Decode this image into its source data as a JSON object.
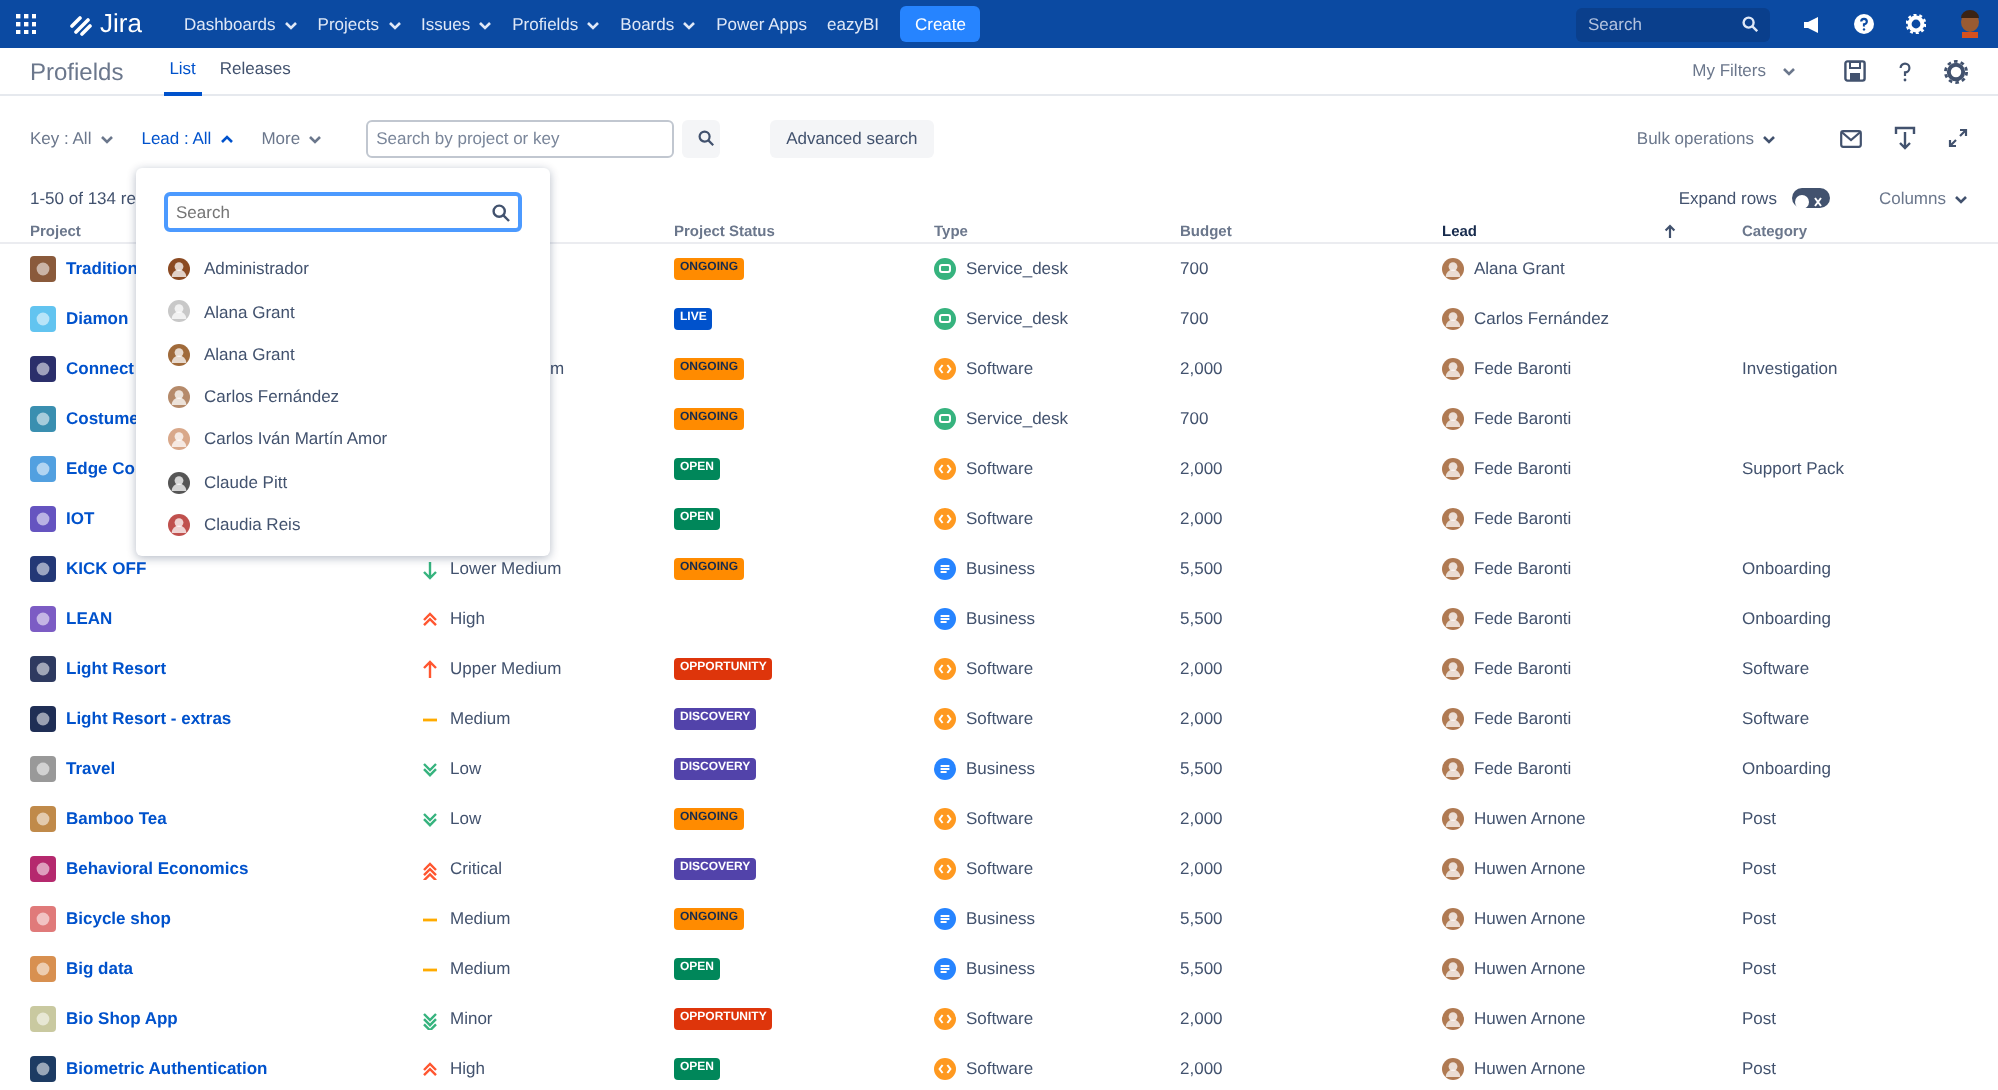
{
  "nav": {
    "logo": "Jira",
    "menus": [
      {
        "label": "Dashboards",
        "has_menu": true
      },
      {
        "label": "Projects",
        "has_menu": true
      },
      {
        "label": "Issues",
        "has_menu": true
      },
      {
        "label": "Profields",
        "has_menu": true
      },
      {
        "label": "Boards",
        "has_menu": true
      },
      {
        "label": "Power Apps",
        "has_menu": false
      },
      {
        "label": "eazyBI",
        "has_menu": false
      }
    ],
    "create": "Create",
    "search": {
      "placeholder": "Search"
    }
  },
  "header": {
    "title": "Profields",
    "tabs": [
      {
        "label": "List",
        "selected": true
      },
      {
        "label": "Releases",
        "selected": false
      }
    ],
    "my_filters": "My Filters"
  },
  "toolbar": {
    "filters": [
      {
        "label": "Key : All",
        "expanded": false
      },
      {
        "label": "Lead : All",
        "expanded": true
      },
      {
        "label": "More",
        "expanded": false
      }
    ],
    "search": {
      "placeholder": "Search by project or key"
    },
    "advanced_search": "Advanced search",
    "bulk_operations": "Bulk operations"
  },
  "results": "1-50 of 134 re",
  "expand_rows": {
    "label": "Expand rows",
    "on": false
  },
  "columns_button": "Columns",
  "table": {
    "columns": [
      {
        "label": "Project",
        "sorted": false
      },
      {
        "label": "Project Status",
        "sorted": false
      },
      {
        "label": "Type",
        "sorted": false
      },
      {
        "label": "Budget",
        "sorted": false
      },
      {
        "label": "Lead",
        "sorted": true
      },
      {
        "label": "Category",
        "sorted": false
      }
    ],
    "rows": [
      {
        "project": "Tradition",
        "status": {
          "label": "ONGOING",
          "kind": "ongoing"
        },
        "type": {
          "label": "Service_desk",
          "kind": "service_desk"
        },
        "budget": "700",
        "lead": "Alana Grant"
      },
      {
        "project": "Diamon",
        "status": {
          "label": "LIVE",
          "kind": "live"
        },
        "type": {
          "label": "Service_desk",
          "kind": "service_desk"
        },
        "budget": "700",
        "lead": "Carlos Fernández"
      },
      {
        "project": "Connect",
        "priority": {
          "label": "m"
        },
        "status": {
          "label": "ONGOING",
          "kind": "ongoing"
        },
        "type": {
          "label": "Software",
          "kind": "software"
        },
        "budget": "2,000",
        "lead": "Fede Baronti",
        "category": "Investigation"
      },
      {
        "project": "Costume",
        "status": {
          "label": "ONGOING",
          "kind": "ongoing"
        },
        "type": {
          "label": "Service_desk",
          "kind": "service_desk"
        },
        "budget": "700",
        "lead": "Fede Baronti"
      },
      {
        "project": "Edge Co",
        "status": {
          "label": "OPEN",
          "kind": "open"
        },
        "type": {
          "label": "Software",
          "kind": "software"
        },
        "budget": "2,000",
        "lead": "Fede Baronti",
        "category": "Support Pack"
      },
      {
        "project": "IOT",
        "status": {
          "label": "OPEN",
          "kind": "open"
        },
        "type": {
          "label": "Software",
          "kind": "software"
        },
        "budget": "2,000",
        "lead": "Fede Baronti"
      },
      {
        "project": "KICK OFF",
        "priority": {
          "label": "Lower Medium",
          "kind": "down"
        },
        "status": {
          "label": "ONGOING",
          "kind": "ongoing"
        },
        "type": {
          "label": "Business",
          "kind": "business"
        },
        "budget": "5,500",
        "lead": "Fede Baronti",
        "category": "Onboarding"
      },
      {
        "project": "LEAN",
        "priority": {
          "label": "High",
          "kind": "double_up"
        },
        "type": {
          "label": "Business",
          "kind": "business"
        },
        "budget": "5,500",
        "lead": "Fede Baronti",
        "category": "Onboarding"
      },
      {
        "project": "Light Resort",
        "priority": {
          "label": "Upper Medium",
          "kind": "up"
        },
        "status": {
          "label": "OPPORTUNITY",
          "kind": "opportunity"
        },
        "type": {
          "label": "Software",
          "kind": "software"
        },
        "budget": "2,000",
        "lead": "Fede Baronti",
        "category": "Software"
      },
      {
        "project": "Light Resort - extras",
        "priority": {
          "label": "Medium",
          "kind": "flat"
        },
        "status": {
          "label": "DISCOVERY",
          "kind": "discovery"
        },
        "type": {
          "label": "Software",
          "kind": "software"
        },
        "budget": "2,000",
        "lead": "Fede Baronti",
        "category": "Software"
      },
      {
        "project": "Travel",
        "priority": {
          "label": "Low",
          "kind": "double_down"
        },
        "status": {
          "label": "DISCOVERY",
          "kind": "discovery"
        },
        "type": {
          "label": "Business",
          "kind": "business"
        },
        "budget": "5,500",
        "lead": "Fede Baronti",
        "category": "Onboarding"
      },
      {
        "project": "Bamboo Tea",
        "priority": {
          "label": "Low",
          "kind": "double_down"
        },
        "status": {
          "label": "ONGOING",
          "kind": "ongoing"
        },
        "type": {
          "label": "Software",
          "kind": "software"
        },
        "budget": "2,000",
        "lead": "Huwen Arnone",
        "category": "Post"
      },
      {
        "project": "Behavioral Economics",
        "priority": {
          "label": "Critical",
          "kind": "triple_up"
        },
        "status": {
          "label": "DISCOVERY",
          "kind": "discovery"
        },
        "type": {
          "label": "Software",
          "kind": "software"
        },
        "budget": "2,000",
        "lead": "Huwen Arnone",
        "category": "Post"
      },
      {
        "project": "Bicycle shop",
        "priority": {
          "label": "Medium",
          "kind": "flat"
        },
        "status": {
          "label": "ONGOING",
          "kind": "ongoing"
        },
        "type": {
          "label": "Business",
          "kind": "business"
        },
        "budget": "5,500",
        "lead": "Huwen Arnone",
        "category": "Post"
      },
      {
        "project": "Big data",
        "priority": {
          "label": "Medium",
          "kind": "flat"
        },
        "status": {
          "label": "OPEN",
          "kind": "open"
        },
        "type": {
          "label": "Business",
          "kind": "business"
        },
        "budget": "5,500",
        "lead": "Huwen Arnone",
        "category": "Post"
      },
      {
        "project": "Bio Shop App",
        "priority": {
          "label": "Minor",
          "kind": "triple_down"
        },
        "status": {
          "label": "OPPORTUNITY",
          "kind": "opportunity"
        },
        "type": {
          "label": "Software",
          "kind": "software"
        },
        "budget": "2,000",
        "lead": "Huwen Arnone",
        "category": "Post"
      },
      {
        "project": "Biometric Authentication",
        "priority": {
          "label": "High",
          "kind": "double_up"
        },
        "status": {
          "label": "OPEN",
          "kind": "open"
        },
        "type": {
          "label": "Software",
          "kind": "software"
        },
        "budget": "2,000",
        "lead": "Huwen Arnone",
        "category": "Post"
      }
    ]
  },
  "lead_dropdown": {
    "search": {
      "placeholder": "Search"
    },
    "users": [
      "Administrador",
      "Alana Grant",
      "Alana Grant",
      "Carlos Fernández",
      "Carlos Iván Martín Amor",
      "Claude Pitt",
      "Claudia Reis"
    ]
  }
}
